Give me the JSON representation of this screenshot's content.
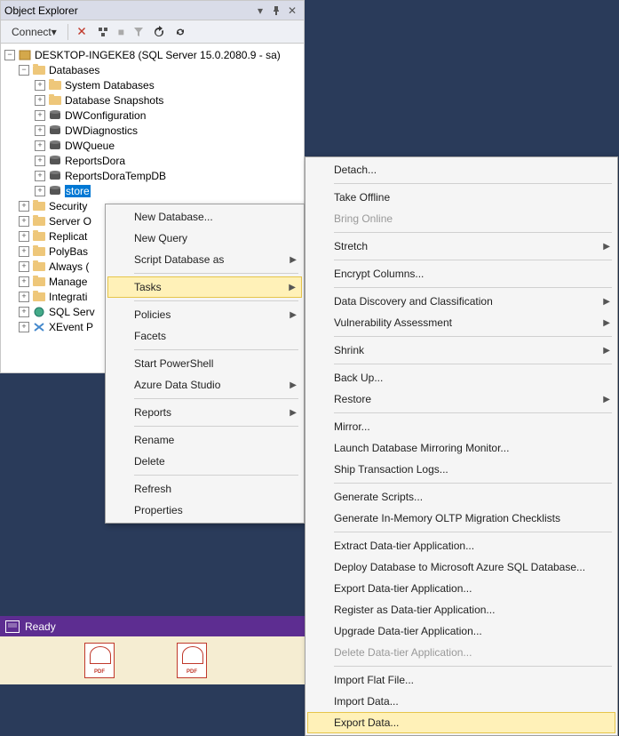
{
  "panel": {
    "title": "Object Explorer",
    "connect": "Connect"
  },
  "tree": {
    "server": "DESKTOP-INGEKE8 (SQL Server 15.0.2080.9 - sa)",
    "databases": "Databases",
    "sysdb": "System Databases",
    "snapshots": "Database Snapshots",
    "dwconfig": "DWConfiguration",
    "dwdiag": "DWDiagnostics",
    "dwqueue": "DWQueue",
    "reportsdora": "ReportsDora",
    "reportstempdb": "ReportsDoraTempDB",
    "store": "store",
    "security": "Security",
    "serverobj": "Server O",
    "replication": "Replicat",
    "polybase": "PolyBas",
    "alwayson": "Always (",
    "management": "Manage",
    "integration": "Integrati",
    "sqlagent": "SQL Serv",
    "xevent": "XEvent P"
  },
  "menu1": {
    "newdb": "New Database...",
    "newquery": "New Query",
    "scriptdb": "Script Database as",
    "tasks": "Tasks",
    "policies": "Policies",
    "facets": "Facets",
    "powershell": "Start PowerShell",
    "azure": "Azure Data Studio",
    "reports": "Reports",
    "rename": "Rename",
    "delete": "Delete",
    "refresh": "Refresh",
    "properties": "Properties"
  },
  "menu2": {
    "detach": "Detach...",
    "offline": "Take Offline",
    "online": "Bring Online",
    "stretch": "Stretch",
    "encrypt": "Encrypt Columns...",
    "discovery": "Data Discovery and Classification",
    "vulnerability": "Vulnerability Assessment",
    "shrink": "Shrink",
    "backup": "Back Up...",
    "restore": "Restore",
    "mirror": "Mirror...",
    "launchmirror": "Launch Database Mirroring Monitor...",
    "shiplog": "Ship Transaction Logs...",
    "genscripts": "Generate Scripts...",
    "oltp": "Generate In-Memory OLTP Migration Checklists",
    "extractdac": "Extract Data-tier Application...",
    "deployazure": "Deploy Database to Microsoft Azure SQL Database...",
    "exportdac": "Export Data-tier Application...",
    "registerdac": "Register as Data-tier Application...",
    "upgradedac": "Upgrade Data-tier Application...",
    "deletedac": "Delete Data-tier Application...",
    "importflat": "Import Flat File...",
    "importdata": "Import Data...",
    "exportdata": "Export Data..."
  },
  "status": "Ready"
}
